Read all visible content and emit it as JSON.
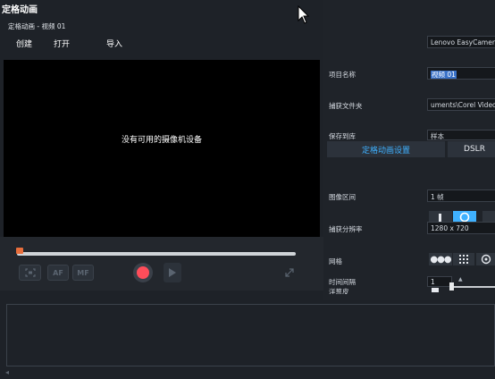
{
  "window": {
    "title": "定格动画",
    "subtitle": "定格动画 - 视频 01"
  },
  "menu": [
    "创建",
    "打开",
    "导入"
  ],
  "preview": {
    "message": "没有可用的摄像机设备"
  },
  "controls": {
    "af_label": "AF",
    "mf_label": "MF"
  },
  "right_panel": {
    "device": "Lenovo EasyCamera",
    "project_name_label": "项目名称",
    "project_name_value": "视频 01",
    "capture_folder_label": "捕获文件夹",
    "capture_folder_value": "uments\\Corel VideoStudio",
    "save_to_library_label": "保存到库",
    "save_to_library_value": "样本",
    "tabs": [
      "定格动画设置",
      "DSLR"
    ],
    "image_duration_label": "图像区间",
    "image_duration_value": "1 帧",
    "capture_resolution_label": "捕获分辨率",
    "capture_resolution_value": "1280 x 720",
    "grid_label": "网格",
    "interval_label": "时间间隔",
    "interval_value": "1",
    "onion_label": "洋葱皮"
  },
  "colors": {
    "accent": "#3fb1ff",
    "record": "#ff4d5a",
    "timeline_head": "#e86e3c"
  }
}
